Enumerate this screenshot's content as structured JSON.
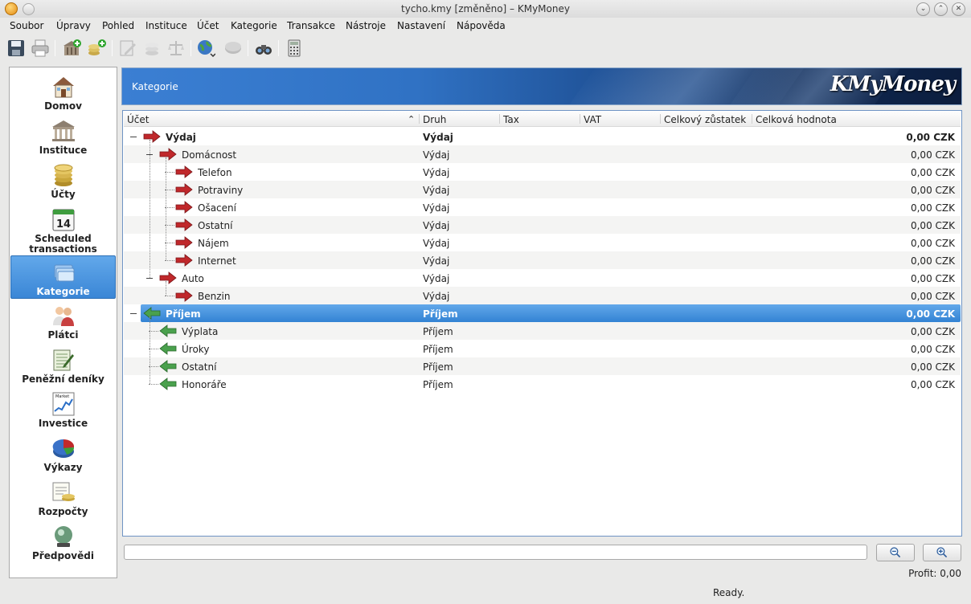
{
  "window": {
    "title": "tycho.kmy [změněno] – KMyMoney"
  },
  "menu": [
    "Soubor",
    "Úpravy",
    "Pohled",
    "Instituce",
    "Účet",
    "Kategorie",
    "Transakce",
    "Nástroje",
    "Nastavení",
    "Nápověda"
  ],
  "toolbar": [
    "save-icon",
    "print-icon",
    "new-institution-icon",
    "new-account-icon",
    "edit-icon",
    "coins-icon",
    "balance-scale-icon",
    "globe-update-icon",
    "reconcile-icon",
    "find-binoculars-icon",
    "calculator-icon"
  ],
  "nav": [
    {
      "label": "Domov",
      "icon": "house-icon"
    },
    {
      "label": "Instituce",
      "icon": "bank-icon"
    },
    {
      "label": "Účty",
      "icon": "coins-icon"
    },
    {
      "label": "Scheduled transactions",
      "calendar_day": "14",
      "icon": "calendar-icon"
    },
    {
      "label": "Kategorie",
      "icon": "folders-icon",
      "active": true
    },
    {
      "label": "Plátci",
      "icon": "payees-icon"
    },
    {
      "label": "Peněžní deníky",
      "icon": "ledger-icon"
    },
    {
      "label": "Investice",
      "market_text": "Market",
      "icon": "market-chart-icon"
    },
    {
      "label": "Výkazy",
      "icon": "pie-chart-icon"
    },
    {
      "label": "Rozpočty",
      "icon": "budget-icon"
    },
    {
      "label": "Předpovědi",
      "icon": "crystal-ball-icon"
    }
  ],
  "header": {
    "title": "Kategorie",
    "logo": "KMyMoney"
  },
  "columns": {
    "ucet": "Účet",
    "druh": "Druh",
    "tax": "Tax",
    "vat": "VAT",
    "celkovy_zustatek": "Celkový zůstatek",
    "celkova_hodnota": "Celková hodnota"
  },
  "rows": [
    {
      "name": "Výdaj",
      "druh": "Výdaj",
      "hodnota": "0,00 CZK",
      "level": 0,
      "type": "expense",
      "bold": true,
      "expanded": true
    },
    {
      "name": "Domácnost",
      "druh": "Výdaj",
      "hodnota": "0,00 CZK",
      "level": 1,
      "type": "expense",
      "expanded": true
    },
    {
      "name": "Telefon",
      "druh": "Výdaj",
      "hodnota": "0,00 CZK",
      "level": 2,
      "type": "expense"
    },
    {
      "name": "Potraviny",
      "druh": "Výdaj",
      "hodnota": "0,00 CZK",
      "level": 2,
      "type": "expense"
    },
    {
      "name": "Ošacení",
      "druh": "Výdaj",
      "hodnota": "0,00 CZK",
      "level": 2,
      "type": "expense"
    },
    {
      "name": "Ostatní",
      "druh": "Výdaj",
      "hodnota": "0,00 CZK",
      "level": 2,
      "type": "expense"
    },
    {
      "name": "Nájem",
      "druh": "Výdaj",
      "hodnota": "0,00 CZK",
      "level": 2,
      "type": "expense"
    },
    {
      "name": "Internet",
      "druh": "Výdaj",
      "hodnota": "0,00 CZK",
      "level": 2,
      "type": "expense"
    },
    {
      "name": "Auto",
      "druh": "Výdaj",
      "hodnota": "0,00 CZK",
      "level": 1,
      "type": "expense",
      "expanded": true
    },
    {
      "name": "Benzin",
      "druh": "Výdaj",
      "hodnota": "0,00 CZK",
      "level": 2,
      "type": "expense"
    },
    {
      "name": "Příjem",
      "druh": "Příjem",
      "hodnota": "0,00 CZK",
      "level": 0,
      "type": "income",
      "bold": true,
      "selected": true,
      "expanded": true
    },
    {
      "name": "Výplata",
      "druh": "Příjem",
      "hodnota": "0,00 CZK",
      "level": 1,
      "type": "income"
    },
    {
      "name": "Úroky",
      "druh": "Příjem",
      "hodnota": "0,00 CZK",
      "level": 1,
      "type": "income"
    },
    {
      "name": "Ostatní",
      "druh": "Příjem",
      "hodnota": "0,00 CZK",
      "level": 1,
      "type": "income"
    },
    {
      "name": "Honoráře",
      "druh": "Příjem",
      "hodnota": "0,00 CZK",
      "level": 1,
      "type": "income"
    }
  ],
  "search": {
    "value": ""
  },
  "footer": {
    "profit": "Profit: 0,00",
    "status": "Ready."
  },
  "colors": {
    "selection": "#3a86d6",
    "expense_arrow": "#c0282b",
    "income_arrow": "#4aa14d",
    "banner_dark": "#0c1d3d"
  }
}
